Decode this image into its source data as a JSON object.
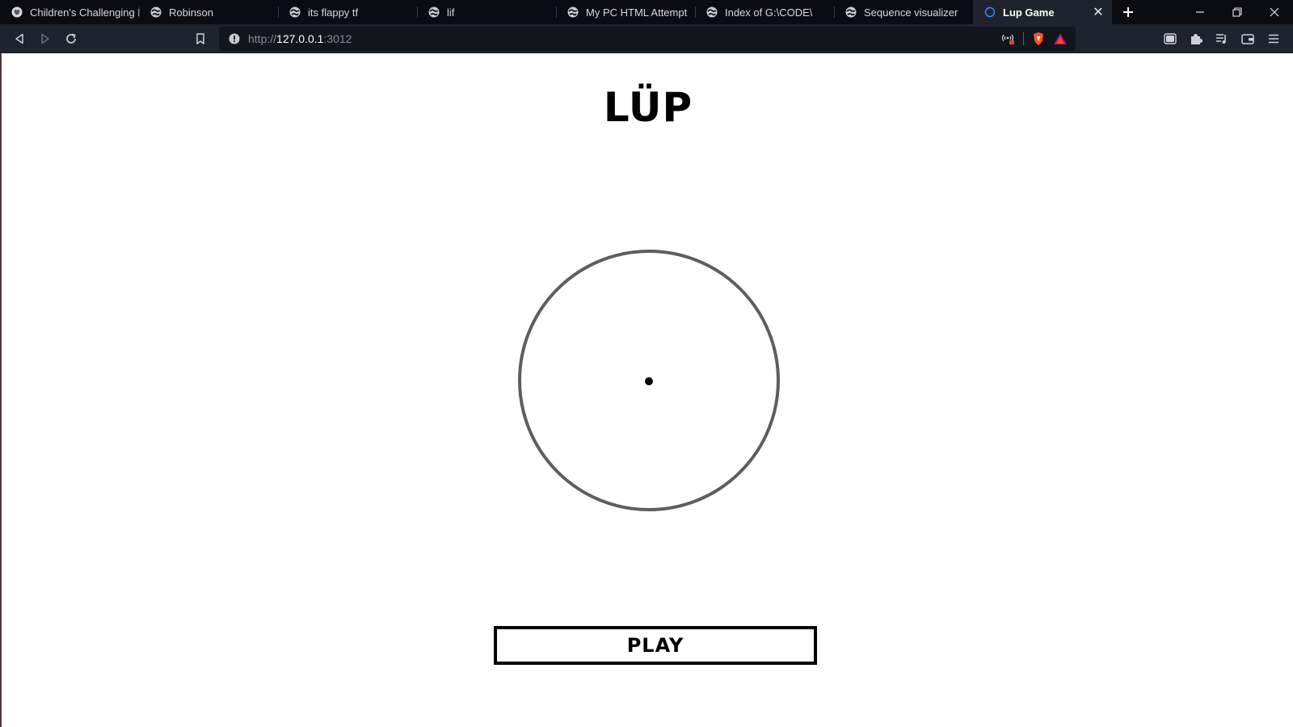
{
  "browser": {
    "tabs": [
      {
        "title": "Children's Challenging Be",
        "favicon": "wolf-favicon-icon",
        "active": false
      },
      {
        "title": "Robinson",
        "favicon": "globe-icon",
        "active": false
      },
      {
        "title": "its flappy tf",
        "favicon": "globe-icon",
        "active": false
      },
      {
        "title": "lif",
        "favicon": "globe-icon",
        "active": false
      },
      {
        "title": "My PC HTML Attempt",
        "favicon": "globe-icon",
        "active": false
      },
      {
        "title": "Index of G:\\CODE\\",
        "favicon": "globe-icon",
        "active": false
      },
      {
        "title": "Sequence visualizer",
        "favicon": "globe-icon",
        "active": false
      },
      {
        "title": "Lup Game",
        "favicon": "loading-ring-icon",
        "active": true
      }
    ],
    "address": {
      "scheme": "http://",
      "host": "127.0.0.1",
      "port": ":3012"
    },
    "colors": {
      "tabbar_bg": "#0b0b13",
      "toolbar_bg": "#1f232e",
      "urlbar_bg": "#13151c",
      "brave_orange": "#fb542b"
    }
  },
  "game": {
    "title": "LÜP",
    "play_label": "PLAY",
    "ring_color": "#5e5e5e",
    "dot_color": "#000000"
  }
}
